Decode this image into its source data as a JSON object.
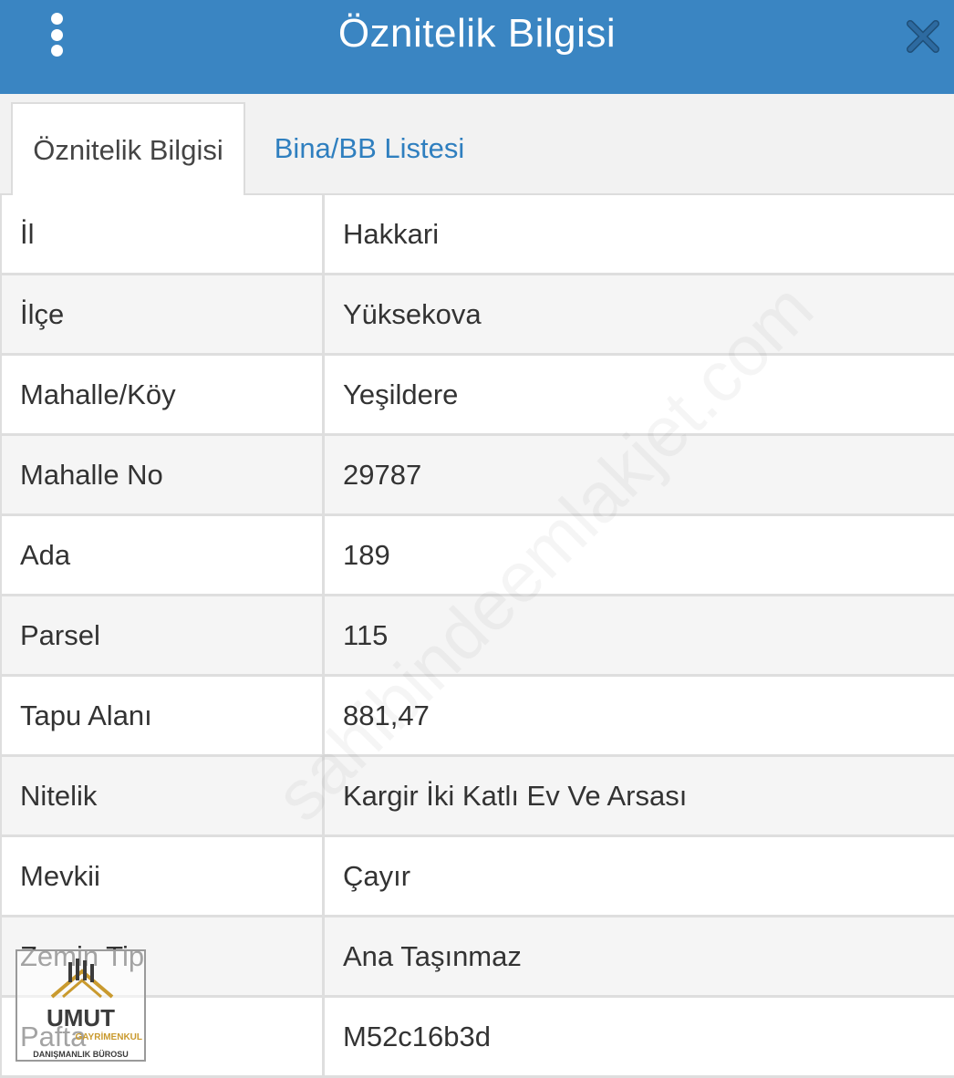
{
  "header": {
    "title": "Öznitelik Bilgisi",
    "menu_icon": "more-vertical-icon",
    "close_icon": "close-icon"
  },
  "tabs": [
    {
      "label": "Öznitelik Bilgisi",
      "active": true
    },
    {
      "label": "Bina/BB Listesi",
      "active": false
    }
  ],
  "rows": [
    {
      "label": "İl",
      "value": "Hakkari"
    },
    {
      "label": "İlçe",
      "value": "Yüksekova"
    },
    {
      "label": "Mahalle/Köy",
      "value": "Yeşildere"
    },
    {
      "label": "Mahalle No",
      "value": "29787"
    },
    {
      "label": "Ada",
      "value": "189"
    },
    {
      "label": "Parsel",
      "value": "115"
    },
    {
      "label": "Tapu Alanı",
      "value": "881,47"
    },
    {
      "label": "Nitelik",
      "value": "Kargir İki Katlı Ev Ve Arsası"
    },
    {
      "label": "Mevkii",
      "value": "Çayır"
    },
    {
      "label": "Zemin Tip",
      "value": "Ana Taşınmaz"
    },
    {
      "label": "Pafta",
      "value": "M52c16b3d"
    }
  ],
  "watermark": "sahibindeemlakjet.com",
  "logo": {
    "name": "UMUT",
    "subtitle": "GAYRİMENKUL",
    "tagline": "DANIŞMANLIK BÜROSU"
  },
  "colors": {
    "header_bg": "#3a85c2",
    "tab_link": "#2f7fbf"
  }
}
